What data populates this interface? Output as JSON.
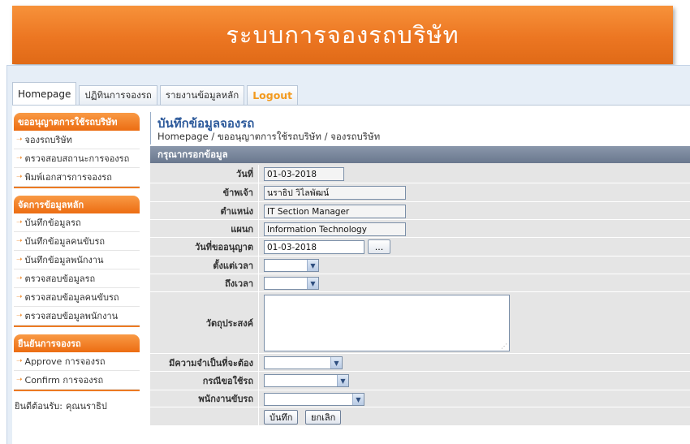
{
  "banner": {
    "title": "ระบบการจองรถบริษัท"
  },
  "tabs": [
    {
      "label": "Homepage"
    },
    {
      "label": "ปฏิทินการจองรถ"
    },
    {
      "label": "รายงานข้อมูลหลัก"
    },
    {
      "label": "Logout"
    }
  ],
  "sidebar": {
    "sections": [
      {
        "title": "ขออนุญาตการใช้รถบริษัท",
        "items": [
          "จองรถบริษัท",
          "ตรวจสอบสถานะการจองรถ",
          "พิมพ์เอกสารการจองรถ"
        ]
      },
      {
        "title": "จัดการข้อมูลหลัก",
        "items": [
          "บันทึกข้อมูลรถ",
          "บันทึกข้อมูลคนขับรถ",
          "บันทึกข้อมูลพนักงาน",
          "ตรวจสอบข้อมูลรถ",
          "ตรวจสอบข้อมูลคนขับรถ",
          "ตรวจสอบข้อมูลพนักงาน"
        ]
      },
      {
        "title": "ยืนยันการจองรถ",
        "items": [
          "Approve การจองรถ",
          "Confirm การจองรถ"
        ]
      }
    ],
    "welcome_label": "ยินดีต้อนรับ:",
    "welcome_user": "คุณนราธิป"
  },
  "main": {
    "title": "บันทึกข้อมูลจองรถ",
    "breadcrumb": "Homepage / ขออนุญาตการใช้รถบริษัท / จองรถบริษัท"
  },
  "form": {
    "header": "กรุณากรอกข้อมูล",
    "date_label": "วันที่",
    "date_value": "01-03-2018",
    "requester_label": "ข้าพเจ้า",
    "requester_value": "นราธิป วิไลพัฒน์",
    "position_label": "ตำแหน่ง",
    "position_value": "IT Section Manager",
    "department_label": "แผนก",
    "department_value": "Information Technology",
    "request_date_label": "วันที่ขออนุญาต",
    "request_date_value": "01-03-2018",
    "picker_label": "...",
    "from_time_label": "ตั้งแต่เวลา",
    "to_time_label": "ถึงเวลา",
    "purpose_label": "วัตถุประสงค์",
    "necessity_label": "มีความจำเป็นที่จะต้อง",
    "request_case_label": "กรณีขอใช้รถ",
    "driver_label": "พนักงานขับรถ",
    "save_label": "บันทึก",
    "cancel_label": "ยกเลิก"
  },
  "colors": {
    "banner": "#ec7622",
    "section_header": "#f08a2c",
    "title": "#2d5a9b",
    "form_header": "#6a788e",
    "logout": "#f39a1e"
  },
  "icons": {
    "sidebar_item": "arrow-right-icon",
    "select": "chevron-down-icon"
  }
}
